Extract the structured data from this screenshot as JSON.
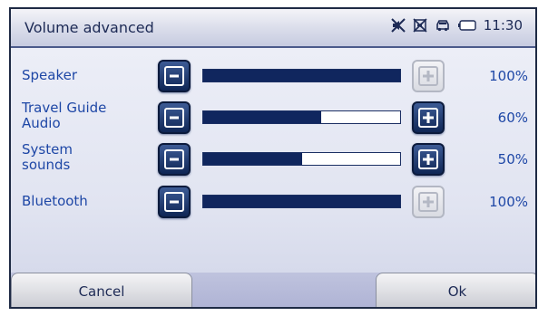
{
  "window": {
    "title": "Volume advanced"
  },
  "status": {
    "time": "11:30",
    "icons": [
      "mute-icon",
      "sound-off-icon",
      "car-icon",
      "battery-icon"
    ]
  },
  "rows": [
    {
      "label_lines": [
        "Speaker"
      ],
      "value": 100,
      "value_text": "100%",
      "plus_enabled": false
    },
    {
      "label_lines": [
        "Travel Guide",
        "Audio"
      ],
      "value": 60,
      "value_text": "60%",
      "plus_enabled": true
    },
    {
      "label_lines": [
        "System",
        "sounds"
      ],
      "value": 50,
      "value_text": "50%",
      "plus_enabled": true
    },
    {
      "label_lines": [
        "Bluetooth"
      ],
      "value": 100,
      "value_text": "100%",
      "plus_enabled": false
    }
  ],
  "footer": {
    "cancel_label": "Cancel",
    "ok_label": "Ok"
  },
  "colors": {
    "accent": "#1e47a6",
    "bar_fill": "#10265e",
    "button_dark": "#1b3468"
  }
}
